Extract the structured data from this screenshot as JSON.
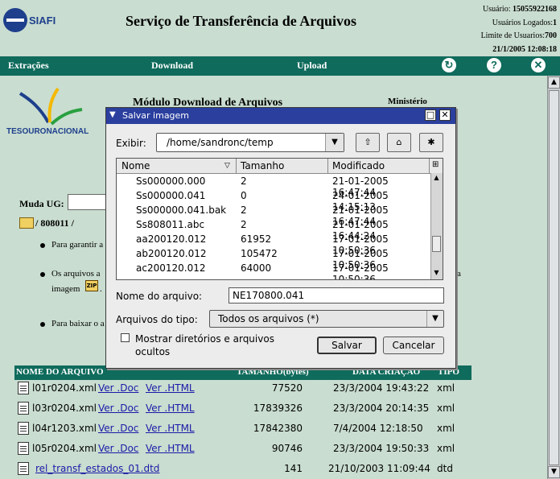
{
  "header": {
    "logo_text": "SIAFI",
    "title": "Serviço de Transferência de Arquivos",
    "user_label": "Usuário:",
    "user_value": "15055922168",
    "logged_label": "Usuários Logados:",
    "logged_value": "1",
    "limit_label": "Limite de Usuarios:",
    "limit_value": "700",
    "datetime": "21/1/2005 12:08:18"
  },
  "nav": {
    "extracoes": "Extrações",
    "download": "Download",
    "upload": "Upload",
    "refresh_icon": "refresh-icon",
    "help_icon": "help-icon",
    "close_icon": "close-icon"
  },
  "page": {
    "tesouro_text": "TESOURONACIONAL",
    "modulo_title": "Módulo Download de Arquivos",
    "ministerio": "Ministério",
    "muda_ug_label": "Muda UG:",
    "path": "/ 808011 /",
    "bullet1": "Para garantir a",
    "bullet2a": "Os arquivos a",
    "bullet2b": "imagem",
    "bullet2c": ".",
    "bullet2_tail": "a",
    "bullet3": "Para baixar o a"
  },
  "files_table": {
    "headers": {
      "name": "NOME DO ARQUIVO",
      "size": "TAMANHO(bytes)",
      "date": "DATA CRIAÇÃO",
      "type": "TIPO"
    },
    "rows": [
      {
        "name": "l01r0204.xml",
        "link1": "Ver .Doc",
        "link2": "Ver .HTML",
        "size": "77520",
        "date": "23/3/2004 19:43:22",
        "type": "xml"
      },
      {
        "name": "l03r0204.xml",
        "link1": "Ver .Doc",
        "link2": "Ver .HTML",
        "size": "17839326",
        "date": "23/3/2004 20:14:35",
        "type": "xml"
      },
      {
        "name": "l04r1203.xml",
        "link1": "Ver .Doc",
        "link2": "Ver .HTML",
        "size": "17842380",
        "date": "7/4/2004 12:18:50",
        "type": "xml"
      },
      {
        "name": "l05r0204.xml",
        "link1": "Ver .Doc",
        "link2": "Ver .HTML",
        "size": "90746",
        "date": "23/3/2004 19:50:33",
        "type": "xml"
      },
      {
        "name": "rel_transf_estados_01.dtd",
        "link1": "",
        "link2": "",
        "size": "141",
        "date": "21/10/2003 11:09:44",
        "type": "dtd"
      }
    ]
  },
  "dialog": {
    "title": "Salvar imagem",
    "exibir_label": "Exibir:",
    "exibir_value": "/home/sandronc/temp",
    "list_headers": {
      "name": "Nome",
      "size": "Tamanho",
      "modified": "Modificado"
    },
    "list_rows": [
      {
        "name": "Ss000000.000",
        "size": "2",
        "modified": "21-01-2005 16:47:44"
      },
      {
        "name": "Ss000000.041",
        "size": "0",
        "modified": "24-01-2005 14:15:13"
      },
      {
        "name": "Ss000000.041.bak",
        "size": "2",
        "modified": "21-01-2005 16:47:44"
      },
      {
        "name": "Ss808011.abc",
        "size": "2",
        "modified": "21-01-2005 16:44:24"
      },
      {
        "name": "aa200120.012",
        "size": "61952",
        "modified": "17-01-2005 10:50:36"
      },
      {
        "name": "ab200120.012",
        "size": "105472",
        "modified": "17-01-2005 10:50:36"
      },
      {
        "name": "ac200120.012",
        "size": "64000",
        "modified": "17-01-2005 10:50:36"
      }
    ],
    "nome_label": "Nome do arquivo:",
    "nome_value": "NE170800.041",
    "tipo_label": "Arquivos do tipo:",
    "tipo_value": "Todos os arquivos (*)",
    "checkbox_label": "Mostrar diretórios e arquivos ocultos",
    "save_label": "Salvar",
    "cancel_label": "Cancelar"
  }
}
